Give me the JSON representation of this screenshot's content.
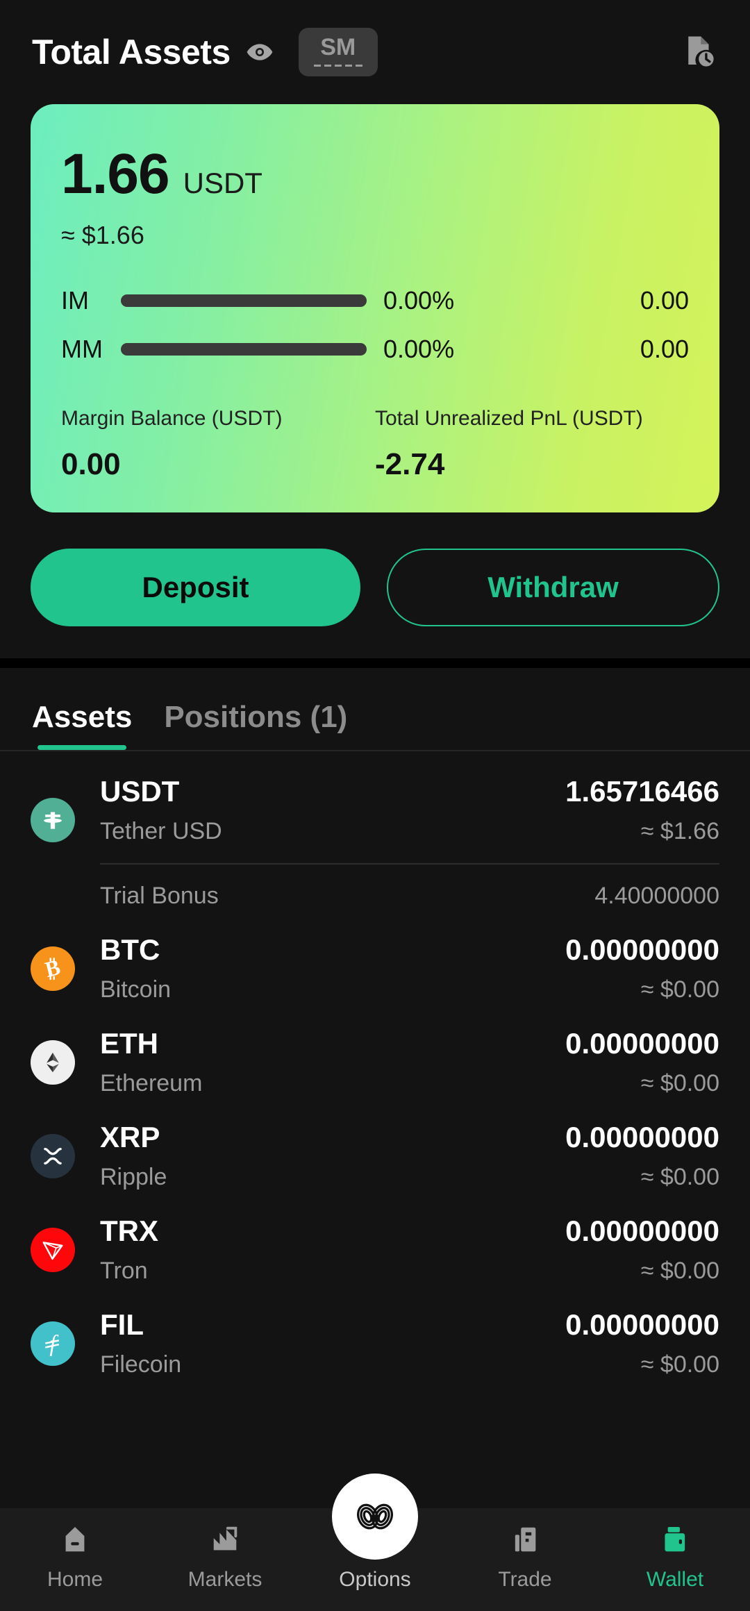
{
  "header": {
    "title": "Total Assets",
    "eye_icon": "eye-icon",
    "account_badge": "SM",
    "history_icon": "document-clock-icon"
  },
  "balance_card": {
    "amount": "1.66",
    "currency": "USDT",
    "approx": "≈ $1.66",
    "margins": [
      {
        "label": "IM",
        "percent": "0.00%",
        "value": "0.00",
        "fill": 0
      },
      {
        "label": "MM",
        "percent": "0.00%",
        "value": "0.00",
        "fill": 0
      }
    ],
    "stats": [
      {
        "label": "Margin Balance (USDT)",
        "value": "0.00"
      },
      {
        "label": "Total Unrealized PnL (USDT)",
        "value": "-2.74"
      }
    ],
    "gradient_start": "#6CEDBF",
    "gradient_end": "#D4F359"
  },
  "actions": {
    "deposit": "Deposit",
    "withdraw": "Withdraw",
    "accent": "#22C48E"
  },
  "tabs": [
    {
      "label": "Assets",
      "active": true
    },
    {
      "label": "Positions (1)",
      "active": false
    }
  ],
  "assets": [
    {
      "symbol": "USDT",
      "name": "Tether USD",
      "amount": "1.65716466",
      "usd": "≈ $1.66",
      "icon": "tether-icon",
      "icon_color": "#50AF95",
      "sub": {
        "label": "Trial Bonus",
        "value": "4.40000000"
      }
    },
    {
      "symbol": "BTC",
      "name": "Bitcoin",
      "amount": "0.00000000",
      "usd": "≈ $0.00",
      "icon": "bitcoin-icon",
      "icon_color": "#F7931A"
    },
    {
      "symbol": "ETH",
      "name": "Ethereum",
      "amount": "0.00000000",
      "usd": "≈ $0.00",
      "icon": "ethereum-icon",
      "icon_color": "#EFEFEF"
    },
    {
      "symbol": "XRP",
      "name": "Ripple",
      "amount": "0.00000000",
      "usd": "≈ $0.00",
      "icon": "ripple-icon",
      "icon_color": "#26333F"
    },
    {
      "symbol": "TRX",
      "name": "Tron",
      "amount": "0.00000000",
      "usd": "≈ $0.00",
      "icon": "tron-icon",
      "icon_color": "#FF060A"
    },
    {
      "symbol": "FIL",
      "name": "Filecoin",
      "amount": "0.00000000",
      "usd": "≈ $0.00",
      "icon": "filecoin-icon",
      "icon_color": "#42C1CA"
    }
  ],
  "bottom_nav": [
    {
      "label": "Home",
      "icon": "home-icon",
      "active": false
    },
    {
      "label": "Markets",
      "icon": "markets-icon",
      "active": false
    },
    {
      "label": "Options",
      "icon": "options-icon",
      "active": false
    },
    {
      "label": "Trade",
      "icon": "trade-icon",
      "active": false
    },
    {
      "label": "Wallet",
      "icon": "wallet-icon",
      "active": true
    }
  ]
}
